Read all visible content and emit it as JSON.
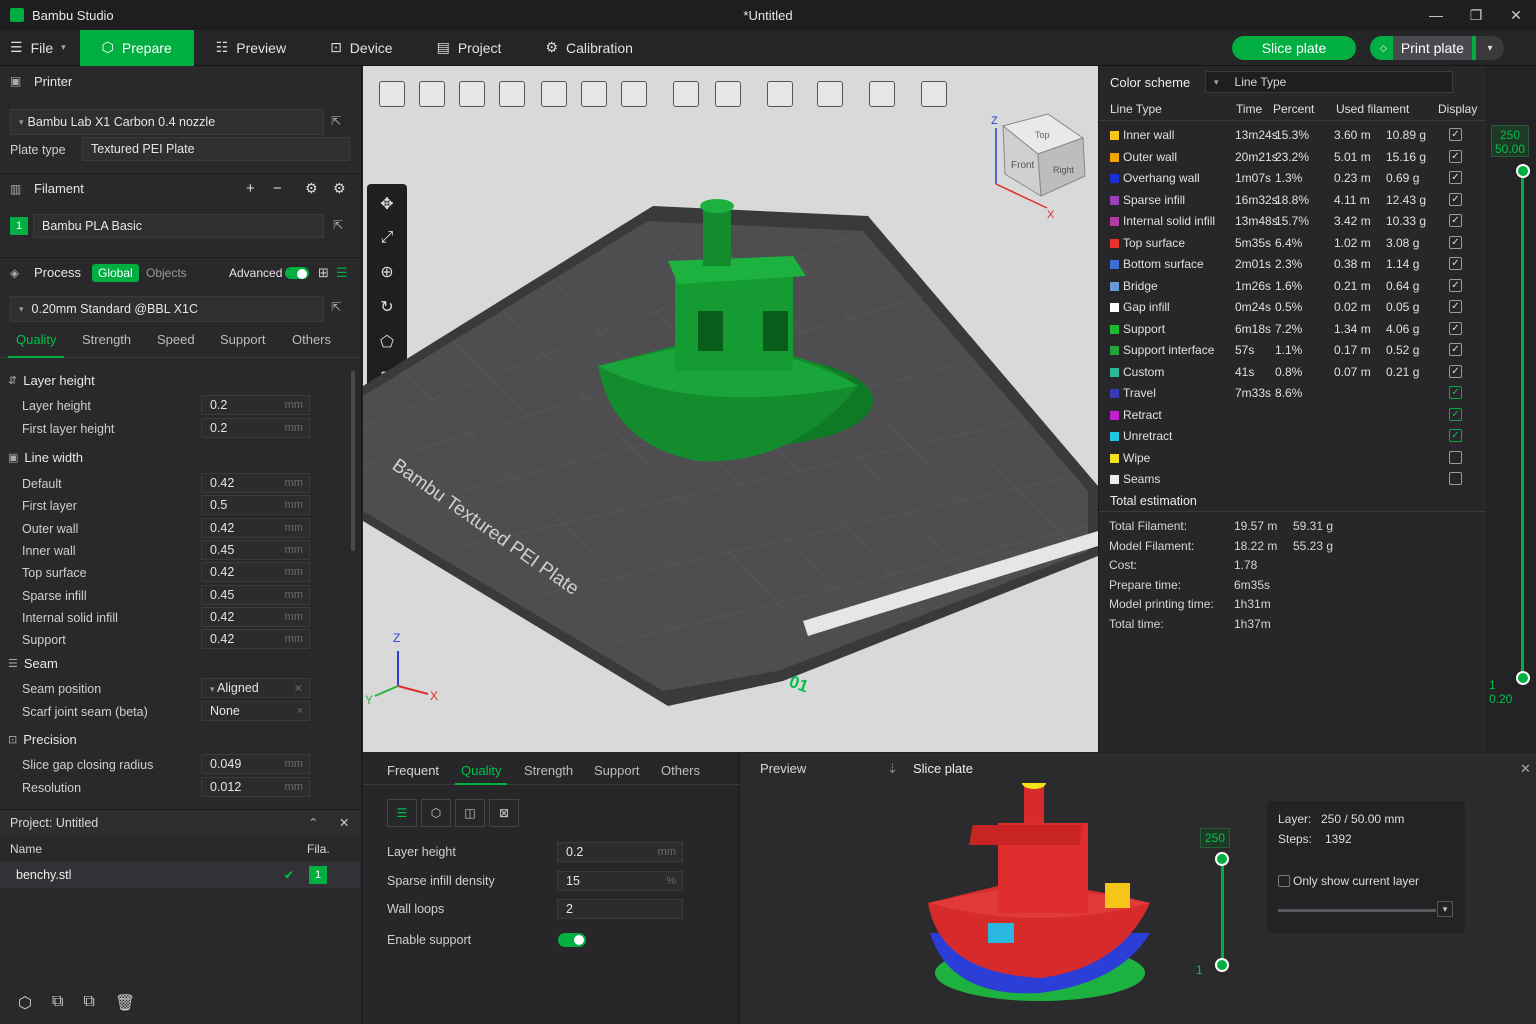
{
  "window": {
    "app_name": "Bambu Studio",
    "doc_title": "*Untitled",
    "min": "—",
    "max": "❐",
    "close": "✕"
  },
  "toolbar": {
    "file": "File",
    "prepare": "Prepare",
    "preview": "Preview",
    "device": "Device",
    "project": "Project",
    "calibration": "Calibration",
    "slice": "Slice plate",
    "print": "Print plate"
  },
  "printer": {
    "header": "Printer",
    "name": "Bambu Lab X1 Carbon 0.4 nozzle",
    "plate_label": "Plate type",
    "plate_value": "Textured PEI Plate"
  },
  "filament": {
    "header": "Filament",
    "index": "1",
    "name": "Bambu PLA Basic"
  },
  "process": {
    "header": "Process",
    "global": "Global",
    "objects": "Objects",
    "advanced": "Advanced",
    "preset": "0.20mm Standard @BBL X1C",
    "tabs": [
      "Quality",
      "Strength",
      "Speed",
      "Support",
      "Others"
    ]
  },
  "settings": {
    "layer_group": "Layer height",
    "layer_rows": [
      {
        "label": "Layer height",
        "value": "0.2",
        "unit": "mm"
      },
      {
        "label": "First layer height",
        "value": "0.2",
        "unit": "mm"
      }
    ],
    "width_group": "Line width",
    "width_rows": [
      {
        "label": "Default",
        "value": "0.42",
        "unit": "mm"
      },
      {
        "label": "First layer",
        "value": "0.5",
        "unit": "mm"
      },
      {
        "label": "Outer wall",
        "value": "0.42",
        "unit": "mm"
      },
      {
        "label": "Inner wall",
        "value": "0.45",
        "unit": "mm"
      },
      {
        "label": "Top surface",
        "value": "0.42",
        "unit": "mm"
      },
      {
        "label": "Sparse infill",
        "value": "0.45",
        "unit": "mm"
      },
      {
        "label": "Internal solid infill",
        "value": "0.42",
        "unit": "mm"
      },
      {
        "label": "Support",
        "value": "0.42",
        "unit": "mm"
      }
    ],
    "seam_group": "Seam",
    "seam_position_label": "Seam position",
    "seam_position_value": "Aligned",
    "scarf_label": "Scarf joint seam (beta)",
    "scarf_value": "None",
    "precision_group": "Precision",
    "precision_rows": [
      {
        "label": "Slice gap closing radius",
        "value": "0.049",
        "unit": "mm"
      },
      {
        "label": "Resolution",
        "value": "0.012",
        "unit": "mm"
      }
    ]
  },
  "project": {
    "title": "Project: Untitled",
    "col_name": "Name",
    "col_fila": "Fila.",
    "file": "benchy.stl",
    "fila": "1"
  },
  "viewport": {
    "plate_text": "Bambu Textured PEI Plate",
    "plate_num": "01",
    "cube_top": "Top",
    "cube_front": "Front",
    "cube_right": "Right",
    "axis_x": "X",
    "axis_y": "Y",
    "axis_z": "Z"
  },
  "legend": {
    "scheme_label": "Color scheme",
    "scheme_value": "Line Type",
    "headers": {
      "type": "Line Type",
      "time": "Time",
      "percent": "Percent",
      "used": "Used filament",
      "display": "Display"
    },
    "rows": [
      {
        "name": "Inner wall",
        "color": "#f5c518",
        "time": "13m24s",
        "pct": "15.3%",
        "len": "3.60 m",
        "wt": "10.89 g",
        "on": true
      },
      {
        "name": "Outer wall",
        "color": "#f0a500",
        "time": "20m21s",
        "pct": "23.2%",
        "len": "5.01 m",
        "wt": "15.16 g",
        "on": true
      },
      {
        "name": "Overhang wall",
        "color": "#1a2fd6",
        "time": "1m07s",
        "pct": "1.3%",
        "len": "0.23 m",
        "wt": "0.69 g",
        "on": true
      },
      {
        "name": "Sparse infill",
        "color": "#9b3fb8",
        "time": "16m32s",
        "pct": "18.8%",
        "len": "4.11 m",
        "wt": "12.43 g",
        "on": true
      },
      {
        "name": "Internal solid infill",
        "color": "#b23ba8",
        "time": "13m48s",
        "pct": "15.7%",
        "len": "3.42 m",
        "wt": "10.33 g",
        "on": true
      },
      {
        "name": "Top surface",
        "color": "#e8322e",
        "time": "5m35s",
        "pct": "6.4%",
        "len": "1.02 m",
        "wt": "3.08 g",
        "on": true
      },
      {
        "name": "Bottom surface",
        "color": "#3e6fd8",
        "time": "2m01s",
        "pct": "2.3%",
        "len": "0.38 m",
        "wt": "1.14 g",
        "on": true
      },
      {
        "name": "Bridge",
        "color": "#6a9ad6",
        "time": "1m26s",
        "pct": "1.6%",
        "len": "0.21 m",
        "wt": "0.64 g",
        "on": true
      },
      {
        "name": "Gap infill",
        "color": "#ffffff",
        "time": "0m24s",
        "pct": "0.5%",
        "len": "0.02 m",
        "wt": "0.05 g",
        "on": true
      },
      {
        "name": "Support",
        "color": "#1fb82e",
        "time": "6m18s",
        "pct": "7.2%",
        "len": "1.34 m",
        "wt": "4.06 g",
        "on": true
      },
      {
        "name": "Support interface",
        "color": "#22a43a",
        "time": "57s",
        "pct": "1.1%",
        "len": "0.17 m",
        "wt": "0.52 g",
        "on": true
      },
      {
        "name": "Custom",
        "color": "#2ab89a",
        "time": "41s",
        "pct": "0.8%",
        "len": "0.07 m",
        "wt": "0.21 g",
        "on": true
      },
      {
        "name": "Travel",
        "color": "#3a3ab8",
        "time": "7m33s",
        "pct": "8.6%",
        "len": "",
        "wt": "",
        "on": true,
        "green": true
      },
      {
        "name": "Retract",
        "color": "#c41fd0",
        "time": "",
        "pct": "",
        "len": "",
        "wt": "",
        "on": true,
        "green": true
      },
      {
        "name": "Unretract",
        "color": "#1fc8e0",
        "time": "",
        "pct": "",
        "len": "",
        "wt": "",
        "on": true,
        "green": true
      },
      {
        "name": "Wipe",
        "color": "#f5e11a",
        "time": "",
        "pct": "",
        "len": "",
        "wt": "",
        "on": false
      },
      {
        "name": "Seams",
        "color": "#ececec",
        "time": "",
        "pct": "",
        "len": "",
        "wt": "",
        "on": false
      }
    ],
    "total_header": "Total estimation",
    "totals": [
      {
        "label": "Total Filament:",
        "v1": "19.57 m",
        "v2": "59.31 g"
      },
      {
        "label": "Model Filament:",
        "v1": "18.22 m",
        "v2": "55.23 g"
      },
      {
        "label": "Cost:",
        "v1": "1.78",
        "v2": ""
      },
      {
        "label": "Prepare time:",
        "v1": "6m35s",
        "v2": ""
      },
      {
        "label": "Model printing time:",
        "v1": "1h31m",
        "v2": ""
      },
      {
        "label": "Total time:",
        "v1": "1h37m",
        "v2": ""
      }
    ]
  },
  "layer_slider": {
    "top_layer": "250",
    "top_height": "50.00",
    "bottom_layer": "1",
    "bottom_height": "0.20"
  },
  "bottom": {
    "tabs": [
      "Frequent",
      "Quality",
      "Strength",
      "Support",
      "Others"
    ],
    "rows": [
      {
        "label": "Layer height",
        "value": "0.2",
        "unit": "mm"
      },
      {
        "label": "Sparse infill density",
        "value": "15",
        "unit": "%"
      },
      {
        "label": "Wall loops",
        "value": "2",
        "unit": ""
      }
    ],
    "support_label": "Enable support"
  },
  "preview_panel": {
    "title": "Preview",
    "slice": "Slice plate",
    "slider_top": "250",
    "slider_bottom": "1",
    "layer_label": "Layer:",
    "layer_value": "250 / 50.00 mm",
    "steps_label": "Steps:",
    "steps_value": "1392",
    "only_current": "Only show current layer"
  }
}
